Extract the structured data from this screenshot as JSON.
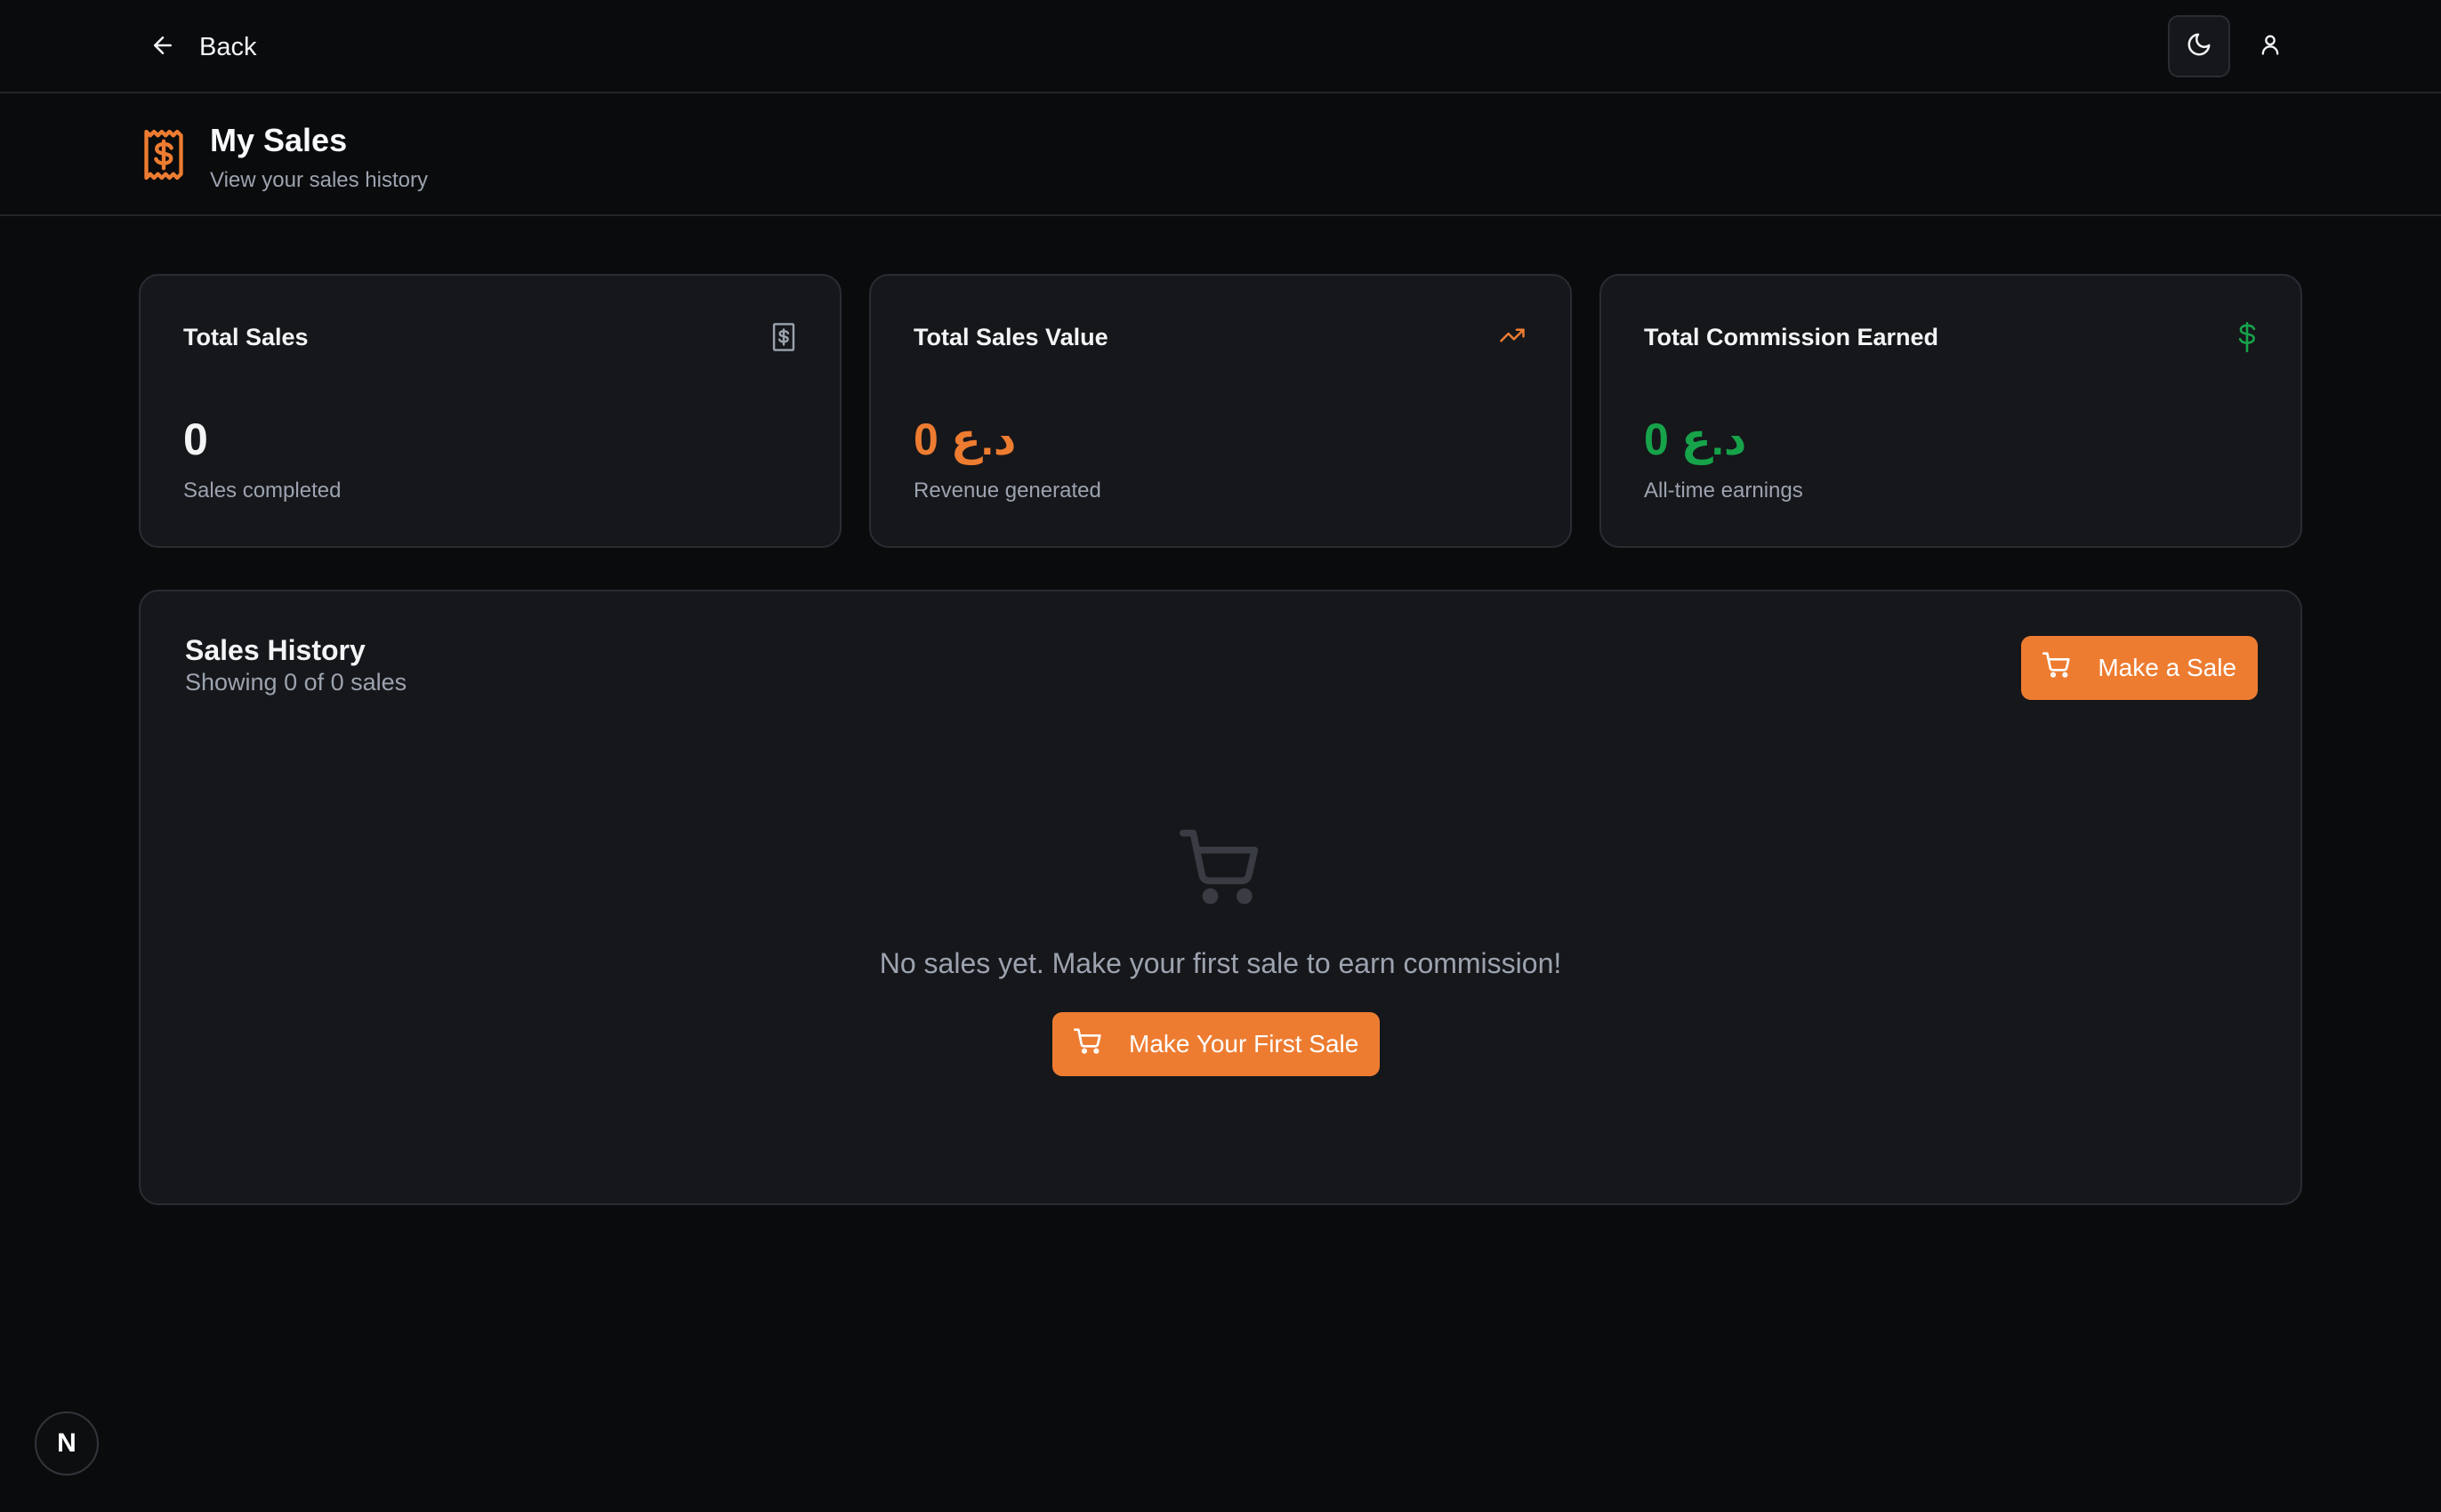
{
  "nav": {
    "back_label": "Back"
  },
  "header": {
    "title": "My Sales",
    "subtitle": "View your sales history"
  },
  "stats": [
    {
      "title": "Total Sales",
      "value": "0",
      "description": "Sales completed",
      "icon": "receipt-icon",
      "color": "#f3f4f6"
    },
    {
      "title": "Total Sales Value",
      "value": "0 د.ع",
      "description": "Revenue generated",
      "icon": "trending-up-icon",
      "color": "#ed7c31"
    },
    {
      "title": "Total Commission Earned",
      "value": "0 د.ع",
      "description": "All-time earnings",
      "icon": "dollar-icon",
      "color": "#16a34a"
    }
  ],
  "history": {
    "title": "Sales History",
    "subtitle": "Showing 0 of 0 sales",
    "make_sale_label": "Make a Sale",
    "empty_text": "No sales yet. Make your first sale to earn commission!",
    "first_sale_label": "Make Your First Sale"
  },
  "badge": {
    "label": "N"
  },
  "colors": {
    "accent": "#ed7c31",
    "success": "#16a34a",
    "background": "#0a0b0d",
    "card": "#16171b"
  }
}
